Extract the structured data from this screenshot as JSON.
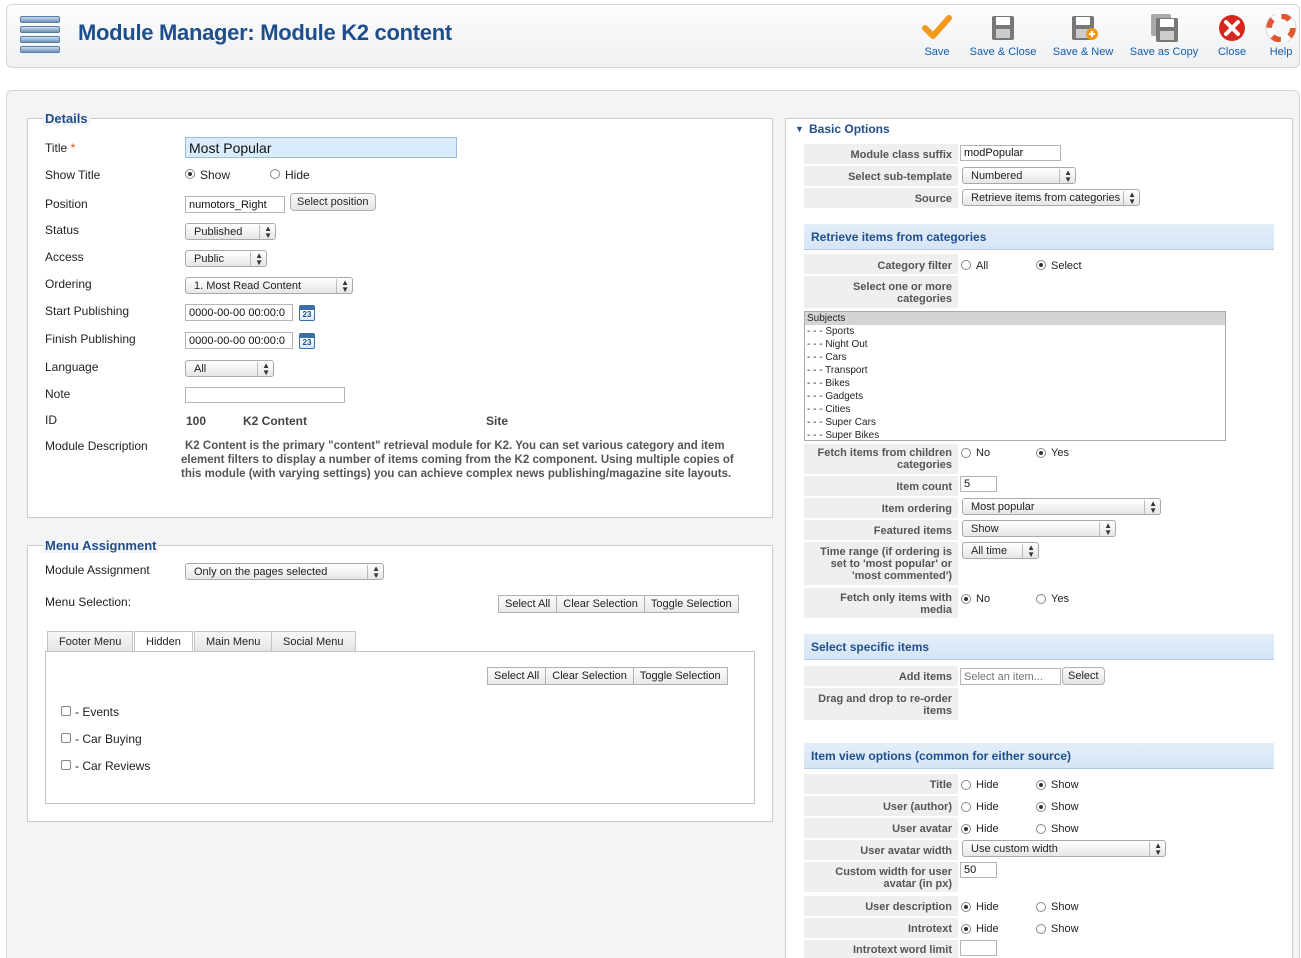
{
  "header": {
    "title": "Module Manager: Module K2 content",
    "toolbar": [
      {
        "label": "Save",
        "icon": "check-icon"
      },
      {
        "label": "Save & Close",
        "icon": "save-icon"
      },
      {
        "label": "Save & New",
        "icon": "save-new-icon"
      },
      {
        "label": "Save as Copy",
        "icon": "save-copy-icon"
      },
      {
        "label": "Close",
        "icon": "close-icon"
      },
      {
        "label": "Help",
        "icon": "help-icon"
      }
    ]
  },
  "details": {
    "legend": "Details",
    "title_label": "Title",
    "required_mark": "*",
    "title_value": "Most Popular",
    "show_title_label": "Show Title",
    "show_option": "Show",
    "hide_option": "Hide",
    "position_label": "Position",
    "position_value": "numotors_Right",
    "select_position_button": "Select position",
    "status_label": "Status",
    "status_value": "Published",
    "access_label": "Access",
    "access_value": "Public",
    "ordering_label": "Ordering",
    "ordering_value": "1. Most Read Content",
    "start_publishing_label": "Start Publishing",
    "start_publishing_value": "0000-00-00 00:00:0",
    "finish_publishing_label": "Finish Publishing",
    "finish_publishing_value": "0000-00-00 00:00:0",
    "calendar_text": "23",
    "language_label": "Language",
    "language_value": "All",
    "note_label": "Note",
    "note_value": "",
    "id_label": "ID",
    "id_value": "100",
    "module_name": "K2 Content",
    "client": "Site",
    "description_label": "Module Description",
    "description_text": "K2 Content is the primary \"content\" retrieval module for K2. You can set various category and item element filters to display a number of items coming from the K2 component. Using multiple copies of this module (with varying settings) you can achieve complex news publishing/magazine site layouts."
  },
  "menu_assignment": {
    "legend": "Menu Assignment",
    "module_assignment_label": "Module Assignment",
    "module_assignment_value": "Only on the pages selected",
    "menu_selection_label": "Menu Selection:",
    "select_all": "Select All",
    "clear_selection": "Clear Selection",
    "toggle_selection": "Toggle Selection",
    "tabs": [
      "Footer Menu",
      "Hidden",
      "Main Menu",
      "Social Menu"
    ],
    "items": [
      "- Events",
      "- Car Buying",
      "- Car Reviews"
    ]
  },
  "basic_options": {
    "title": "Basic Options",
    "module_class_suffix_label": "Module class suffix",
    "module_class_suffix_value": "modPopular",
    "sub_template_label": "Select sub-template",
    "sub_template_value": "Numbered",
    "source_label": "Source",
    "source_value": "Retrieve items from categories"
  },
  "retrieve_categories": {
    "title": "Retrieve items from categories",
    "category_filter_label": "Category filter",
    "all_option": "All",
    "select_option": "Select",
    "select_categories_label_1": "Select one or more",
    "select_categories_label_2": "categories",
    "categories": [
      "Subjects",
      "- - - Sports",
      "- - - Night Out",
      "- - - Cars",
      "- - - Transport",
      "- - - Bikes",
      "- - - Gadgets",
      "- - - Cities",
      "- - - Super Cars",
      "- - - Super Bikes"
    ],
    "fetch_children_label_1": "Fetch items from children",
    "fetch_children_label_2": "categories",
    "no_option": "No",
    "yes_option": "Yes",
    "item_count_label": "Item count",
    "item_count_value": "5",
    "item_ordering_label": "Item ordering",
    "item_ordering_value": "Most popular",
    "featured_items_label": "Featured items",
    "featured_items_value": "Show",
    "time_range_label_1": "Time range (if ordering is",
    "time_range_label_2": "set to 'most popular' or",
    "time_range_label_3": "'most commented')",
    "time_range_value": "All time",
    "fetch_media_label_1": "Fetch only items with",
    "fetch_media_label_2": "media"
  },
  "specific_items": {
    "title": "Select specific items",
    "add_items_label": "Add items",
    "add_items_placeholder": "Select an item...",
    "select_button": "Select",
    "drag_label_1": "Drag and drop to re-order",
    "drag_label_2": "items"
  },
  "item_view": {
    "title": "Item view options (common for either source)",
    "hide_option": "Hide",
    "show_option": "Show",
    "title_label": "Title",
    "user_author_label": "User (author)",
    "user_avatar_label": "User avatar",
    "avatar_width_label": "User avatar width",
    "avatar_width_value": "Use custom width",
    "custom_width_label_1": "Custom width for user",
    "custom_width_label_2": "avatar (in px)",
    "custom_width_value": "50",
    "user_description_label": "User description",
    "introtext_label": "Introtext",
    "introtext_limit_label": "Introtext word limit",
    "introtext_limit_value": ""
  }
}
